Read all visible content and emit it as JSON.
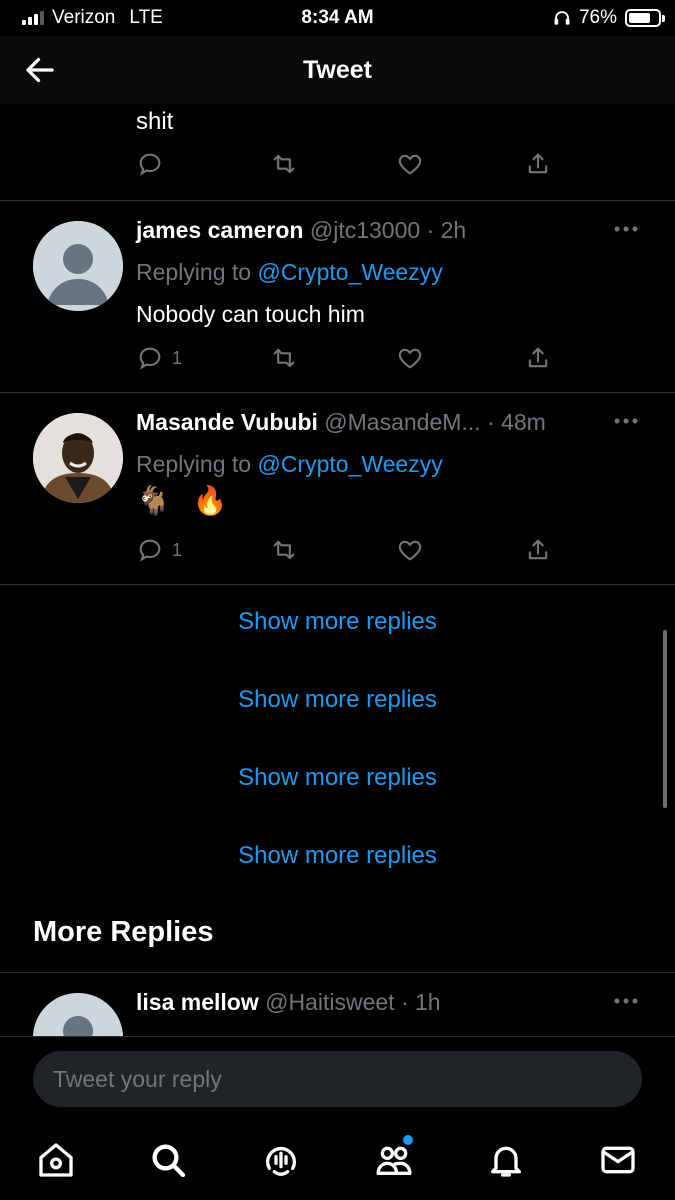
{
  "status_bar": {
    "carrier": "Verizon",
    "network": "LTE",
    "time": "8:34 AM",
    "battery": "76%",
    "battery_level": 0.76
  },
  "header": {
    "title": "Tweet",
    "back_icon": "arrow-left-icon"
  },
  "fragment": {
    "text": "shit"
  },
  "tweets": [
    {
      "name": "james cameron",
      "handle": "@jtc13000",
      "time": "2h",
      "replying_prefix": "Replying to",
      "mention": "@Crypto_Weezyy",
      "text": "Nobody can touch him",
      "reply_count": "1"
    },
    {
      "name": "Masande Vububi",
      "handle": "@MasandeM...",
      "time": "48m",
      "replying_prefix": "Replying to",
      "mention": "@Crypto_Weezyy",
      "emojis": [
        "🐐",
        "🔥"
      ],
      "reply_count": "1"
    }
  ],
  "show_more": [
    "Show more replies",
    "Show more replies",
    "Show more replies",
    "Show more replies"
  ],
  "more_replies": {
    "title": "More Replies",
    "next_tweet": {
      "name": "lisa mellow",
      "handle": "@Haitisweet",
      "time": "1h"
    }
  },
  "reply_bar": {
    "placeholder": "Tweet your reply"
  },
  "nav": {
    "items": [
      "home-icon",
      "search-icon",
      "spaces-icon",
      "communities-icon",
      "notifications-icon",
      "messages-icon"
    ]
  },
  "colors": {
    "accent": "#1d9bf0",
    "muted": "#71767b",
    "background": "#000000"
  }
}
